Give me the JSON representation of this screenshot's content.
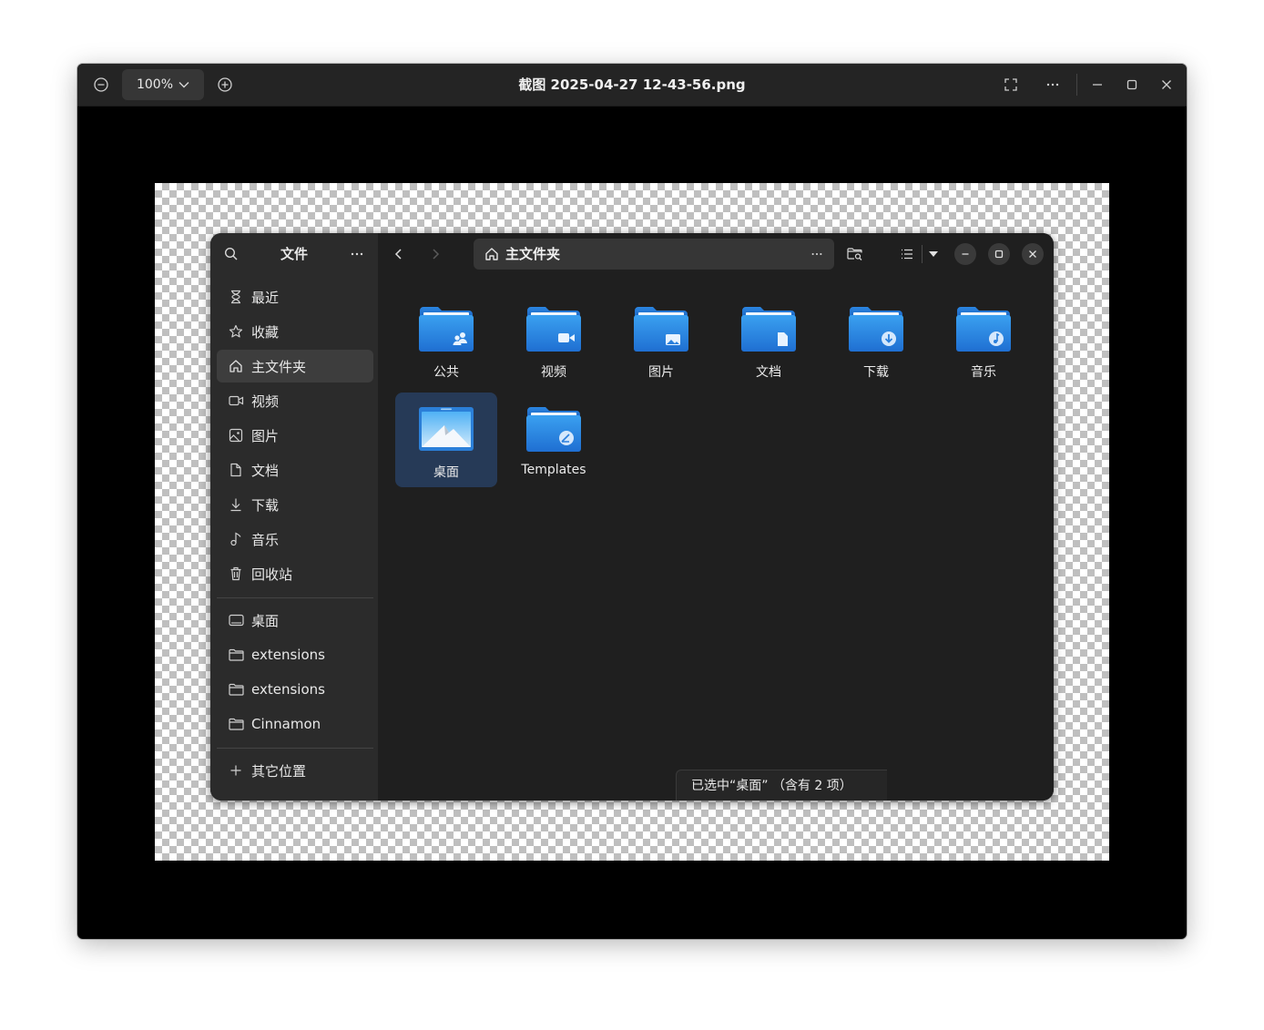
{
  "viewer": {
    "title": "截图 2025-04-27 12-43-56.png",
    "zoom": "100%",
    "icons": [
      "zoom-out-icon",
      "chevron-down-icon",
      "zoom-in-icon",
      "fullscreen-icon",
      "more-icon",
      "minimize-icon",
      "maximize-icon",
      "close-icon"
    ]
  },
  "file_manager": {
    "sidebar": {
      "title": "文件",
      "places": [
        {
          "label": "最近",
          "icon": "recent-icon"
        },
        {
          "label": "收藏",
          "icon": "star-icon"
        },
        {
          "label": "主文件夹",
          "icon": "home-icon",
          "active": true
        },
        {
          "label": "视频",
          "icon": "video-icon"
        },
        {
          "label": "图片",
          "icon": "image-icon"
        },
        {
          "label": "文档",
          "icon": "document-icon"
        },
        {
          "label": "下载",
          "icon": "download-icon"
        },
        {
          "label": "音乐",
          "icon": "music-icon"
        },
        {
          "label": "回收站",
          "icon": "trash-icon"
        }
      ],
      "bookmarks": [
        {
          "label": "桌面",
          "icon": "desktop-icon"
        },
        {
          "label": "extensions",
          "icon": "folder-icon"
        },
        {
          "label": "extensions",
          "icon": "folder-icon"
        },
        {
          "label": "Cinnamon",
          "icon": "folder-icon"
        }
      ],
      "other_locations": "其它位置"
    },
    "path": "主文件夹",
    "items": [
      {
        "label": "公共",
        "icon": "folder-public-icon"
      },
      {
        "label": "视频",
        "icon": "folder-videos-icon"
      },
      {
        "label": "图片",
        "icon": "folder-pictures-icon"
      },
      {
        "label": "文档",
        "icon": "folder-documents-icon"
      },
      {
        "label": "下载",
        "icon": "folder-download-icon"
      },
      {
        "label": "音乐",
        "icon": "folder-music-icon"
      },
      {
        "label": "桌面",
        "icon": "folder-desktop-icon",
        "selected": true
      },
      {
        "label": "Templates",
        "icon": "folder-templates-icon"
      }
    ],
    "status": "已选中“桌面” （含有 2 项）",
    "colors": {
      "accent": "#2f8fe8",
      "selection": "#263a57"
    }
  }
}
